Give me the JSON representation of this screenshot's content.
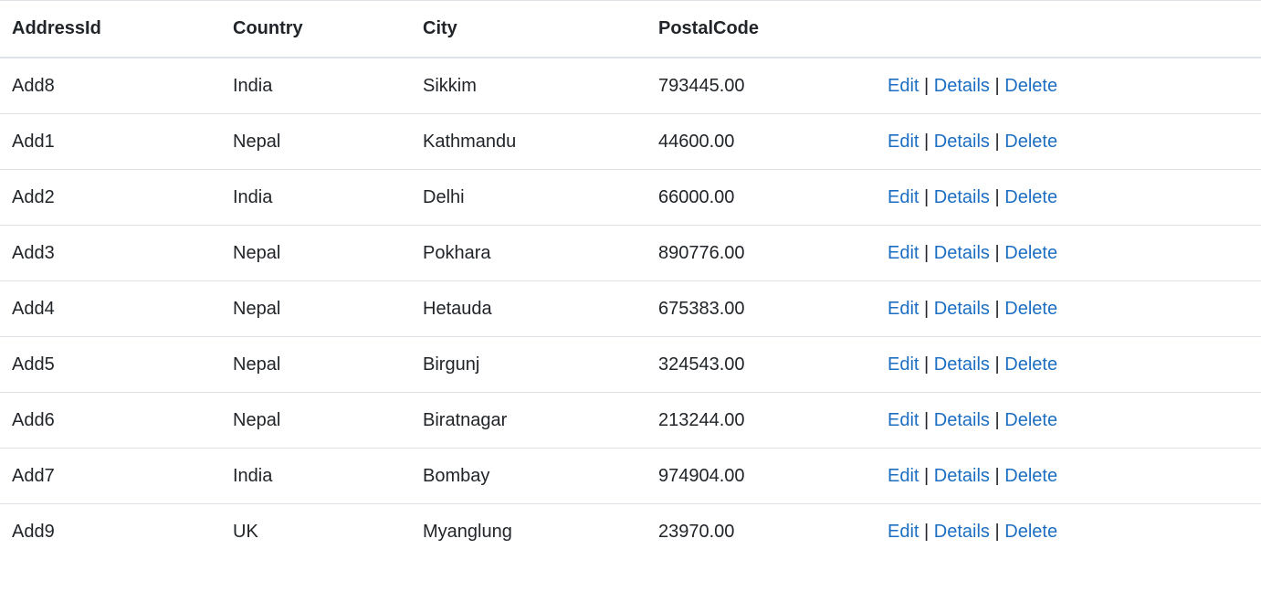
{
  "table": {
    "headers": {
      "address_id": "AddressId",
      "country": "Country",
      "city": "City",
      "postal_code": "PostalCode",
      "actions": ""
    },
    "actions": {
      "edit": "Edit",
      "details": "Details",
      "delete": "Delete",
      "separator": "|"
    },
    "rows": [
      {
        "address_id": "Add8",
        "country": "India",
        "city": "Sikkim",
        "postal_code": "793445.00"
      },
      {
        "address_id": "Add1",
        "country": "Nepal",
        "city": "Kathmandu",
        "postal_code": "44600.00"
      },
      {
        "address_id": "Add2",
        "country": "India",
        "city": "Delhi",
        "postal_code": "66000.00"
      },
      {
        "address_id": "Add3",
        "country": "Nepal",
        "city": "Pokhara",
        "postal_code": "890776.00"
      },
      {
        "address_id": "Add4",
        "country": "Nepal",
        "city": "Hetauda",
        "postal_code": "675383.00"
      },
      {
        "address_id": "Add5",
        "country": "Nepal",
        "city": "Birgunj",
        "postal_code": "324543.00"
      },
      {
        "address_id": "Add6",
        "country": "Nepal",
        "city": "Biratnagar",
        "postal_code": "213244.00"
      },
      {
        "address_id": "Add7",
        "country": "India",
        "city": "Bombay",
        "postal_code": "974904.00"
      },
      {
        "address_id": "Add9",
        "country": "UK",
        "city": "Myanglung",
        "postal_code": "23970.00"
      }
    ],
    "colors": {
      "link": "#1b6ec2",
      "text": "#212529",
      "border": "#dee2e6"
    }
  }
}
